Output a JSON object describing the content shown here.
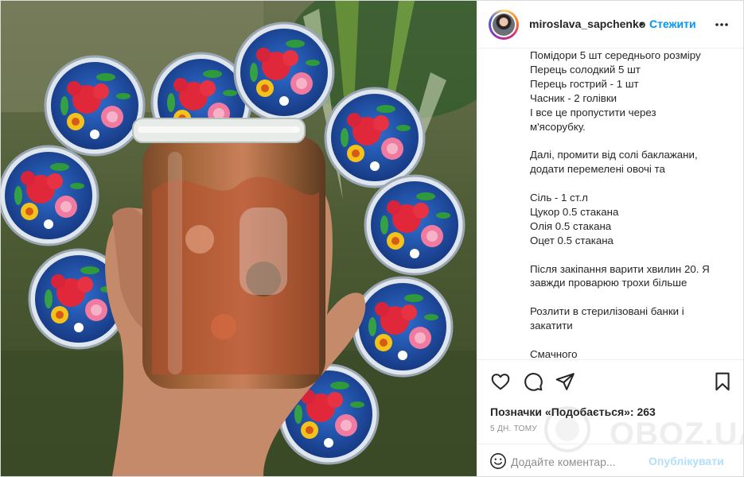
{
  "post": {
    "username": "miroslava_sapchenko",
    "separator": "•",
    "follow_label": "Стежити"
  },
  "caption": {
    "lines": [
      "Помідори 5 шт середнього розміру",
      "Перець солодкий 5 шт",
      "Перець гострий - 1 шт",
      "Часник - 2 голівки",
      "І все це пропустити через",
      "м'ясорубку.",
      "",
      "Далі, промити від солі баклажани,",
      "додати перемелені овочі та ",
      "",
      "Сіль - 1 ст.л",
      "Цукор 0.5 стакана",
      "Олія 0.5 стакана",
      "Оцет 0.5 стакана",
      "",
      "Після закіпання варити хвилин 20. Я",
      "завжди проварюю трохи більше",
      "",
      "Розлити в стерилізовані банки і",
      "закатити",
      "",
      "Смачного"
    ]
  },
  "engagement": {
    "likes_label": "Позначки «Подобається»: 263",
    "time_ago": "5 ДН. ТОМУ"
  },
  "comment": {
    "placeholder": "Додайте коментар...",
    "publish_label": "Опублікувати"
  },
  "watermark": {
    "text": "OBOZ.UA"
  },
  "icons": {
    "like": "heart-icon",
    "comment": "comment-icon",
    "share": "send-icon",
    "save": "bookmark-icon",
    "more": "more-options-icon",
    "emoji": "emoji-icon"
  },
  "colors": {
    "link_blue": "#0095f6",
    "publish_disabled": "#b2dffc",
    "muted": "#8e8e8e"
  }
}
